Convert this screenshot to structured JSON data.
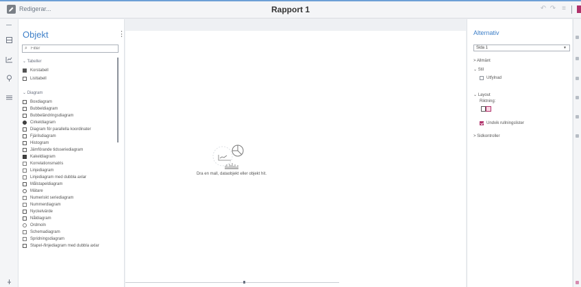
{
  "topbar": {
    "edit_label": "Redigerar...",
    "report_title": "Rapport 1"
  },
  "objects": {
    "title": "Objekt",
    "menu_glyph": "⋮",
    "filter_placeholder": "Filter",
    "groups": {
      "tables": "Tabeller",
      "charts": "Diagram"
    },
    "tables": [
      {
        "label": "Korstabell",
        "icon": "crosstab-icon"
      },
      {
        "label": "Listtabell",
        "icon": "list-table-icon"
      }
    ],
    "charts": [
      {
        "label": "Boxdiagram",
        "icon": "box-plot-icon"
      },
      {
        "label": "Bubbeldiagram",
        "icon": "bubble-plot-icon"
      },
      {
        "label": "Bubbeländringsdiagram",
        "icon": "bubble-change-plot-icon"
      },
      {
        "label": "Cirkeldiagram",
        "icon": "pie-chart-icon"
      },
      {
        "label": "Diagram för parallella koordinater",
        "icon": "parallel-coordinates-icon"
      },
      {
        "label": "Fjärilsdiagram",
        "icon": "butterfly-chart-icon"
      },
      {
        "label": "Histogram",
        "icon": "histogram-icon"
      },
      {
        "label": "Jämförande tidsseriediagram",
        "icon": "comparative-time-series-icon"
      },
      {
        "label": "Kakeldiagram",
        "icon": "heat-map-icon"
      },
      {
        "label": "Korrelationsmatris",
        "icon": "correlation-matrix-icon"
      },
      {
        "label": "Linjediagram",
        "icon": "line-chart-icon"
      },
      {
        "label": "Linjediagram med dubbla axlar",
        "icon": "dual-axis-line-icon"
      },
      {
        "label": "Målstapeldiagram",
        "icon": "target-bar-icon"
      },
      {
        "label": "Mätare",
        "icon": "gauge-icon"
      },
      {
        "label": "Numeriskt seriediagram",
        "icon": "numeric-series-icon"
      },
      {
        "label": "Nummerdiagram",
        "icon": "number-plot-icon"
      },
      {
        "label": "Nyckelvärde",
        "icon": "key-value-icon"
      },
      {
        "label": "Nåldiagram",
        "icon": "needle-plot-icon"
      },
      {
        "label": "Ordmoln",
        "icon": "word-cloud-icon"
      },
      {
        "label": "Schemadiagram",
        "icon": "schedule-chart-icon"
      },
      {
        "label": "Spridningsdiagram",
        "icon": "scatter-plot-icon"
      },
      {
        "label": "Stapel-/linjediagram med dubbla axlar",
        "icon": "dual-axis-bar-line-icon"
      }
    ]
  },
  "canvas": {
    "drop_hint": "Dra en mall, dataobjekt eller objekt hit."
  },
  "options": {
    "title": "Alternativ",
    "page_select_value": "Sida 1",
    "sections": {
      "general": "Allmänt",
      "style": "Stil",
      "layout": "Layout",
      "page_controls": "Sidkontroller"
    },
    "filled_label": "Utfylnad",
    "direction_label": "Riktning:",
    "avoid_scroll_label": "Undvik rullningslister",
    "filled_checked": false,
    "avoid_scroll_checked": true
  },
  "colors": {
    "accent": "#3d7fc8",
    "brand": "#b0306a"
  }
}
